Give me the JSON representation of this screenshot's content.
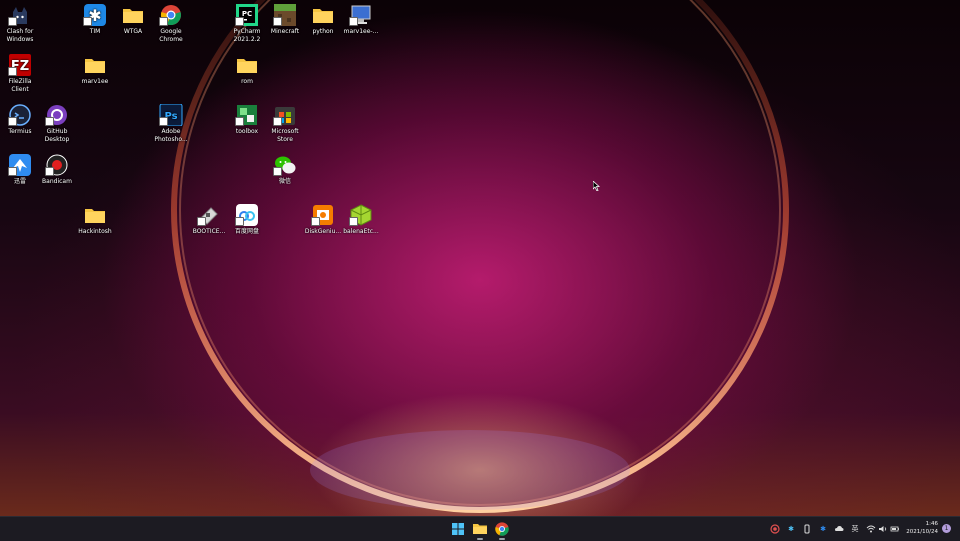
{
  "desktop": {
    "icons": [
      {
        "label": "Clash for Windows",
        "icon": "clash-cat-icon"
      },
      {
        "label": "FileZilla Client",
        "icon": "filezilla-icon"
      },
      {
        "label": "Termius",
        "icon": "termius-icon"
      },
      {
        "label": "迅雷",
        "icon": "xunlei-bird-icon"
      },
      {
        "label": "TIM",
        "icon": "tim-icon"
      },
      {
        "label": "marv1ee",
        "icon": "folder-icon"
      },
      {
        "label": "GitHub Desktop",
        "icon": "github-icon"
      },
      {
        "label": "Bandicam",
        "icon": "bandicam-icon"
      },
      {
        "label": "Hackintosh",
        "icon": "folder-icon"
      },
      {
        "label": "WTGA",
        "icon": "folder-icon"
      },
      {
        "label": "Google Chrome",
        "icon": "chrome-icon"
      },
      {
        "label": "Adobe Photosho...",
        "icon": "photoshop-icon"
      },
      {
        "label": "BOOTICE...",
        "icon": "bootice-icon"
      },
      {
        "label": "PyCharm 2021.2.2",
        "icon": "pycharm-icon"
      },
      {
        "label": "rom",
        "icon": "folder-icon"
      },
      {
        "label": "toolbox",
        "icon": "toolbox-icon"
      },
      {
        "label": "百度网盘",
        "icon": "baidu-netdisk-icon"
      },
      {
        "label": "Minecraft",
        "icon": "minecraft-icon"
      },
      {
        "label": "Microsoft Store",
        "icon": "store-icon"
      },
      {
        "label": "微信",
        "icon": "wechat-icon"
      },
      {
        "label": "python",
        "icon": "folder-icon"
      },
      {
        "label": "DiskGeniu...",
        "icon": "diskgenius-icon"
      },
      {
        "label": "marv1ee-...",
        "icon": "computer-icon"
      },
      {
        "label": "balenaEtc...",
        "icon": "balena-etcher-icon"
      }
    ]
  },
  "taskbar": {
    "apps": [
      {
        "name": "start",
        "icon": "windows-start-icon"
      },
      {
        "name": "file-explorer",
        "icon": "folder-icon"
      },
      {
        "name": "chrome",
        "icon": "chrome-icon"
      }
    ],
    "tray": {
      "ime": "英",
      "time": "1:46",
      "date": "2021/10/24",
      "notification_count": "1"
    }
  },
  "colors": {
    "taskbar": "#1c1b22",
    "accent": "#4fc3f7",
    "folder": "#f5c542"
  }
}
